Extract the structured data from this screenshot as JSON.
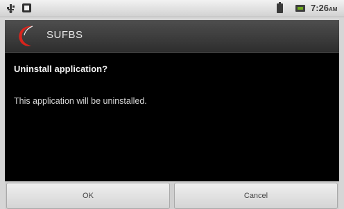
{
  "status_bar": {
    "icons": [
      "usb-icon",
      "sd-card-icon",
      "battery-icon",
      "signal-icon"
    ],
    "time": "7:26",
    "ampm": "AM"
  },
  "dialog": {
    "app_name": "SUFBS",
    "title": "Uninstall application?",
    "message": "This application will be uninstalled.",
    "ok_label": "OK",
    "cancel_label": "Cancel",
    "accent_color": "#d9241c"
  }
}
